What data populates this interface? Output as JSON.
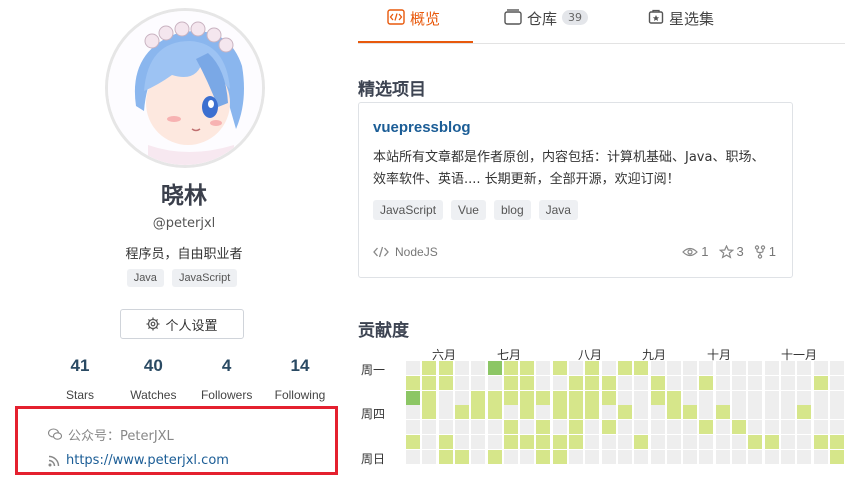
{
  "profile": {
    "name": "晓林",
    "login": "@peterjxl",
    "bio": "程序员，自由职业者",
    "languages": [
      "Java",
      "JavaScript"
    ],
    "settings_label": "个人设置",
    "stats": [
      {
        "num": "41",
        "label": "Stars"
      },
      {
        "num": "40",
        "label": "Watches"
      },
      {
        "num": "4",
        "label": "Followers"
      },
      {
        "num": "14",
        "label": "Following"
      }
    ],
    "wechat": "公众号：PeterJXL",
    "website": "https://www.peterjxl.com"
  },
  "tabs": [
    {
      "label": "概览",
      "icon": "code-icon",
      "active": true
    },
    {
      "label": "仓库",
      "icon": "repo-icon",
      "count": "39"
    },
    {
      "label": "星选集",
      "icon": "star-collection-icon"
    }
  ],
  "featured": {
    "title": "精选项目",
    "repo": {
      "name": "vuepressblog",
      "description": "本站所有文章都是作者原创，内容包括：计算机基础、Java、职场、效率软件、英语.... 长期更新，全部开源，欢迎订阅！",
      "tags": [
        "JavaScript",
        "Vue",
        "blog",
        "Java"
      ],
      "language": "NodeJS",
      "watches": "1",
      "stars": "3",
      "forks": "1"
    }
  },
  "contrib": {
    "title": "贡献度",
    "months": [
      "六月",
      "七月",
      "八月",
      "九月",
      "十月",
      "十一月"
    ],
    "days": [
      "周一",
      "周四",
      "周日"
    ],
    "colors": {
      "empty": "#eeeeee",
      "light": "#d6e68a",
      "mid": "#8cc665"
    },
    "levels": [
      [
        0,
        1,
        1,
        0,
        0,
        2,
        1,
        1,
        0,
        1,
        0,
        1,
        0,
        1,
        1,
        0,
        0,
        0,
        0,
        0,
        0,
        0,
        0,
        0,
        0,
        0,
        0,
        0
      ],
      [
        1,
        1,
        1,
        0,
        0,
        0,
        1,
        1,
        0,
        0,
        1,
        1,
        1,
        0,
        0,
        1,
        0,
        0,
        1,
        0,
        0,
        0,
        0,
        0,
        0,
        1,
        0,
        0
      ],
      [
        2,
        1,
        0,
        0,
        1,
        1,
        1,
        1,
        1,
        1,
        1,
        1,
        1,
        0,
        0,
        1,
        1,
        0,
        0,
        0,
        0,
        0,
        0,
        0,
        0,
        0,
        0,
        0
      ],
      [
        0,
        1,
        0,
        1,
        1,
        1,
        0,
        1,
        0,
        1,
        1,
        1,
        0,
        1,
        0,
        0,
        1,
        1,
        0,
        1,
        0,
        0,
        0,
        0,
        1,
        0,
        0,
        0
      ],
      [
        0,
        0,
        0,
        0,
        0,
        0,
        1,
        0,
        1,
        0,
        1,
        0,
        1,
        0,
        0,
        0,
        0,
        0,
        1,
        0,
        1,
        0,
        0,
        0,
        0,
        0,
        0,
        0
      ],
      [
        1,
        0,
        1,
        0,
        0,
        0,
        1,
        1,
        1,
        1,
        1,
        0,
        0,
        0,
        1,
        0,
        0,
        0,
        0,
        0,
        0,
        1,
        1,
        0,
        0,
        1,
        1,
        0
      ],
      [
        0,
        0,
        1,
        1,
        0,
        1,
        0,
        0,
        1,
        1,
        0,
        0,
        0,
        0,
        0,
        0,
        0,
        0,
        0,
        0,
        0,
        0,
        0,
        0,
        0,
        0,
        1,
        0
      ]
    ]
  }
}
